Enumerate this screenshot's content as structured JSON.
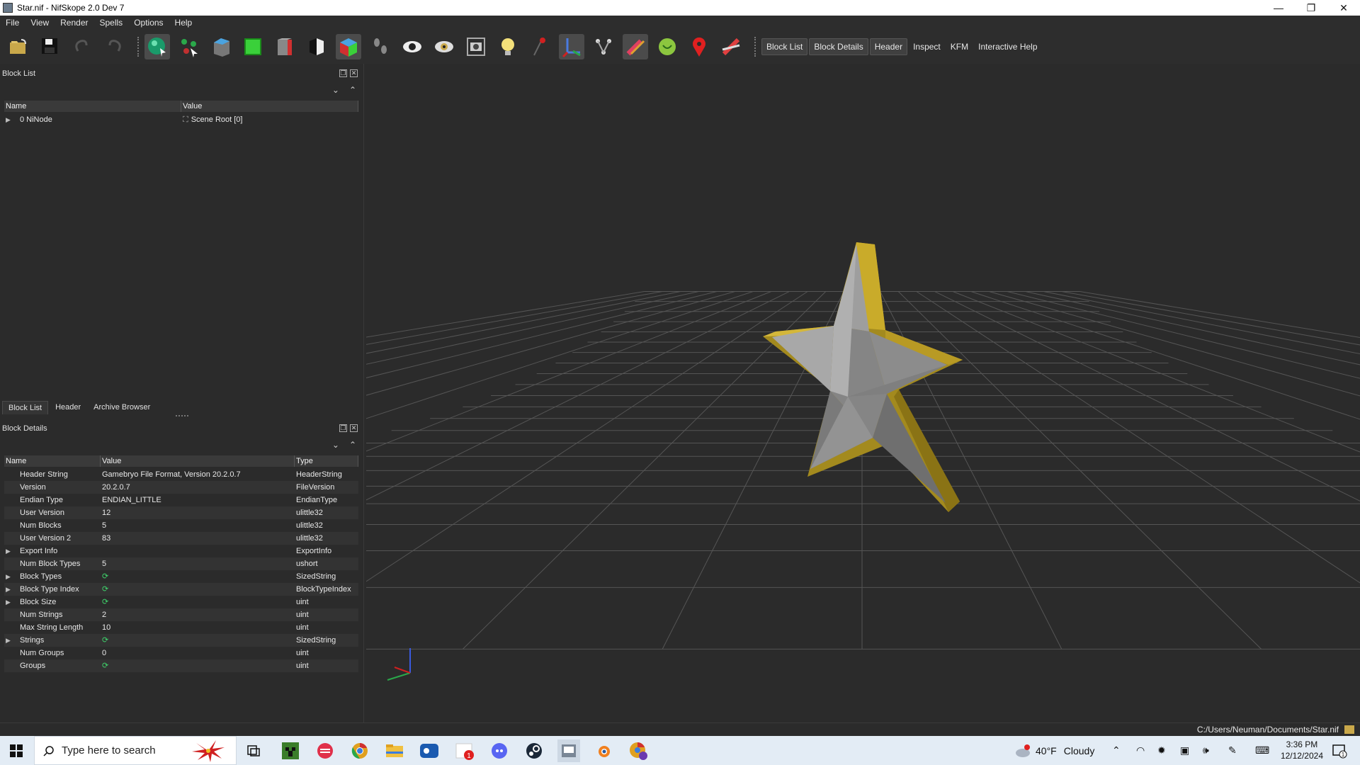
{
  "window": {
    "title": "Star.nif - NifSkope 2.0 Dev 7",
    "controls": {
      "minimize": "—",
      "maximize": "❐",
      "close": "✕"
    }
  },
  "menu": {
    "items": [
      "File",
      "View",
      "Render",
      "Spells",
      "Options",
      "Help"
    ]
  },
  "toolbar": {
    "icons": [
      "load-icon",
      "save-icon",
      "undo-icon",
      "redo-icon",
      "select-object-icon",
      "select-vertex-icon",
      "view-top-icon",
      "view-front-icon",
      "view-side-icon",
      "view-flip-icon",
      "view-perspective-icon",
      "walk-mode-icon",
      "show-hidden-icon",
      "show-nodes-icon",
      "screenshot-icon",
      "lighting-icon",
      "show-axes-icon",
      "show-grid-icon",
      "show-skeleton-icon",
      "show-constraints-icon",
      "show-havok-icon",
      "show-markers-icon",
      "do-vertex-colors-icon"
    ],
    "text_buttons": [
      "Block List",
      "Block Details",
      "Header",
      "Inspect",
      "KFM",
      "Interactive Help"
    ]
  },
  "block_list": {
    "title": "Block List",
    "columns": [
      "Name",
      "Value"
    ],
    "rows": [
      {
        "name": "0 NiNode",
        "value": "Scene Root [0]"
      }
    ],
    "tabs": [
      "Block List",
      "Header",
      "Archive Browser"
    ]
  },
  "block_details": {
    "title": "Block Details",
    "columns": [
      "Name",
      "Value",
      "Type"
    ],
    "rows": [
      {
        "name": "Header String",
        "value": "Gamebryo File Format, Version 20.2.0.7",
        "type": "HeaderString",
        "expandable": false
      },
      {
        "name": "Version",
        "value": "20.2.0.7",
        "type": "FileVersion",
        "expandable": false
      },
      {
        "name": "Endian Type",
        "value": "ENDIAN_LITTLE",
        "type": "EndianType",
        "expandable": false
      },
      {
        "name": "User Version",
        "value": "12",
        "type": "ulittle32",
        "expandable": false
      },
      {
        "name": "Num Blocks",
        "value": "5",
        "type": "ulittle32",
        "expandable": false
      },
      {
        "name": "User Version 2",
        "value": "83",
        "type": "ulittle32",
        "expandable": false
      },
      {
        "name": "Export Info",
        "value": "",
        "type": "ExportInfo",
        "expandable": true
      },
      {
        "name": "Num Block Types",
        "value": "5",
        "type": "ushort",
        "expandable": false
      },
      {
        "name": "Block Types",
        "value": "",
        "type": "SizedString",
        "expandable": true,
        "array": true
      },
      {
        "name": "Block Type Index",
        "value": "",
        "type": "BlockTypeIndex",
        "expandable": true,
        "array": true
      },
      {
        "name": "Block Size",
        "value": "",
        "type": "uint",
        "expandable": true,
        "array": true
      },
      {
        "name": "Num Strings",
        "value": "2",
        "type": "uint",
        "expandable": false
      },
      {
        "name": "Max String Length",
        "value": "10",
        "type": "uint",
        "expandable": false
      },
      {
        "name": "Strings",
        "value": "",
        "type": "SizedString",
        "expandable": true,
        "array": true
      },
      {
        "name": "Num Groups",
        "value": "0",
        "type": "uint",
        "expandable": false
      },
      {
        "name": "Groups",
        "value": "",
        "type": "uint",
        "expandable": false,
        "array": true
      }
    ]
  },
  "status_bar": {
    "path": "C:/Users/Neuman/Documents/Star.nif"
  },
  "taskbar": {
    "search_placeholder": "Type here to search",
    "apps": [
      "poinsettia-icon",
      "task-view-icon",
      "minecraft-icon",
      "app-red-icon",
      "chrome-icon",
      "file-explorer-icon",
      "app-blue-icon",
      "app-badge-icon",
      "discord-icon",
      "steam-icon",
      "nifskope-icon",
      "blender-icon",
      "chrome-profile-icon"
    ],
    "weather": {
      "temp": "40°F",
      "condition": "Cloudy"
    },
    "clock": {
      "time": "3:36 PM",
      "date": "12/12/2024"
    },
    "notification_count": "1"
  },
  "colors": {
    "star_gold": "#a38a1e",
    "star_silver": "#8a8a8a",
    "grid": "#5a5a5a",
    "background": "#2b2b2b"
  }
}
